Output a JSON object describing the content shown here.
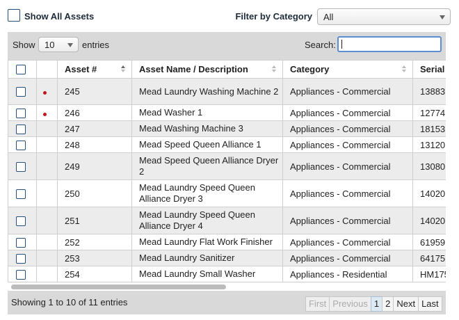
{
  "top": {
    "show_all_label": "Show All Assets",
    "filter_label": "Filter by Category",
    "filter_value": "All"
  },
  "controls": {
    "show_label": "Show",
    "length_value": "10",
    "entries_label": "entries",
    "search_label": "Search:",
    "search_value": ""
  },
  "table": {
    "columns": [
      "Asset #",
      "Asset Name / Description",
      "Category",
      "Serial #"
    ],
    "rows": [
      {
        "dot": true,
        "asset": "245",
        "name": "Mead Laundry Washing Machine 2",
        "category": "Appliances - Commercial",
        "serial": "13883"
      },
      {
        "dot": true,
        "asset": "246",
        "name": "Mead Washer 1",
        "category": "Appliances - Commercial",
        "serial": "12774"
      },
      {
        "dot": false,
        "asset": "247",
        "name": "Mead Washing Machine 3",
        "category": "Appliances - Commercial",
        "serial": "18153"
      },
      {
        "dot": false,
        "asset": "248",
        "name": "Mead Speed Queen Alliance 1",
        "category": "Appliances - Commercial",
        "serial": "13120"
      },
      {
        "dot": false,
        "asset": "249",
        "name": "Mead Speed Queen Alliance Dryer 2",
        "category": "Appliances - Commercial",
        "serial": "13080"
      },
      {
        "dot": false,
        "asset": "250",
        "name": "Mead Laundry Speed Queen Alliance Dryer 3",
        "category": "Appliances - Commercial",
        "serial": "14020"
      },
      {
        "dot": false,
        "asset": "251",
        "name": "Mead Laundry Speed Queen Alliance Dryer 4",
        "category": "Appliances - Commercial",
        "serial": "14020"
      },
      {
        "dot": false,
        "asset": "252",
        "name": "Mead Laundry Flat Work Finisher",
        "category": "Appliances - Commercial",
        "serial": "61959"
      },
      {
        "dot": false,
        "asset": "253",
        "name": "Mead Laundry Sanitizer",
        "category": "Appliances - Commercial",
        "serial": "64175"
      },
      {
        "dot": false,
        "asset": "254",
        "name": "Mead Laundry Small Washer",
        "category": "Appliances - Residential",
        "serial": "HM175"
      }
    ]
  },
  "footer": {
    "info": "Showing 1 to 10 of 11 entries",
    "pager": {
      "first": "First",
      "previous": "Previous",
      "page1": "1",
      "page2": "2",
      "next": "Next",
      "last": "Last"
    }
  },
  "colors": {
    "accent": "#24507a",
    "status_dot": "#c0161e",
    "panel": "#d9d9d9"
  }
}
